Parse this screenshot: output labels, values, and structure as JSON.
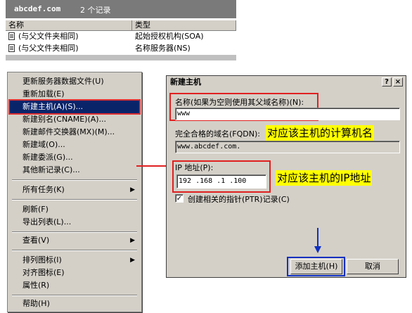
{
  "list_panel": {
    "domain": "abcdef.com",
    "record_count": "2 个记录",
    "columns": [
      "名称",
      "类型"
    ],
    "rows": [
      {
        "name": "(与父文件夹相同)",
        "type": "起始授权机构(SOA)",
        "icon": "record-icon"
      },
      {
        "name": "(与父文件夹相同)",
        "type": "名称服务器(NS)",
        "icon": "record-icon"
      }
    ]
  },
  "context_menu": {
    "items": [
      {
        "label": "更新服务器数据文件(U)"
      },
      {
        "label": "重新加载(E)"
      },
      {
        "label": "新建主机(A)(S)...",
        "selected": true
      },
      {
        "label": "新建别名(CNAME)(A)..."
      },
      {
        "label": "新建邮件交换器(MX)(M)..."
      },
      {
        "label": "新建域(O)..."
      },
      {
        "label": "新建委派(G)..."
      },
      {
        "label": "其他新记录(C)..."
      },
      {
        "label": "所有任务(K)",
        "submenu": true
      },
      {
        "label": "刷新(F)"
      },
      {
        "label": "导出列表(L)..."
      },
      {
        "label": "查看(V)",
        "submenu": true
      },
      {
        "label": "排列图标(I)",
        "submenu": true
      },
      {
        "label": "对齐图标(E)"
      },
      {
        "label": "属性(R)"
      },
      {
        "label": "帮助(H)"
      }
    ]
  },
  "dialog": {
    "title": "新建主机",
    "help_btn": "?",
    "close_btn": "×",
    "name_label": "名称(如果为空则使用其父域名称)(N):",
    "name_value": "www",
    "fqdn_label": "完全合格的域名(FQDN):",
    "fqdn_value": "www.abcdef.com.",
    "ip_label": "IP 地址(P):",
    "ip_value": "192 .168 .1   .100",
    "ptr_label": "创建相关的指针(PTR)记录(C)",
    "ptr_checked": true,
    "ok_label": "添加主机(H)",
    "cancel_label": "取消"
  },
  "annotations": {
    "note_host": "对应该主机的计算机名",
    "note_ip": "对应该主机的IP地址",
    "arrow_color": "#e02020",
    "down_arrow_color": "#1030c0",
    "highlight_color": "#ffff00"
  }
}
